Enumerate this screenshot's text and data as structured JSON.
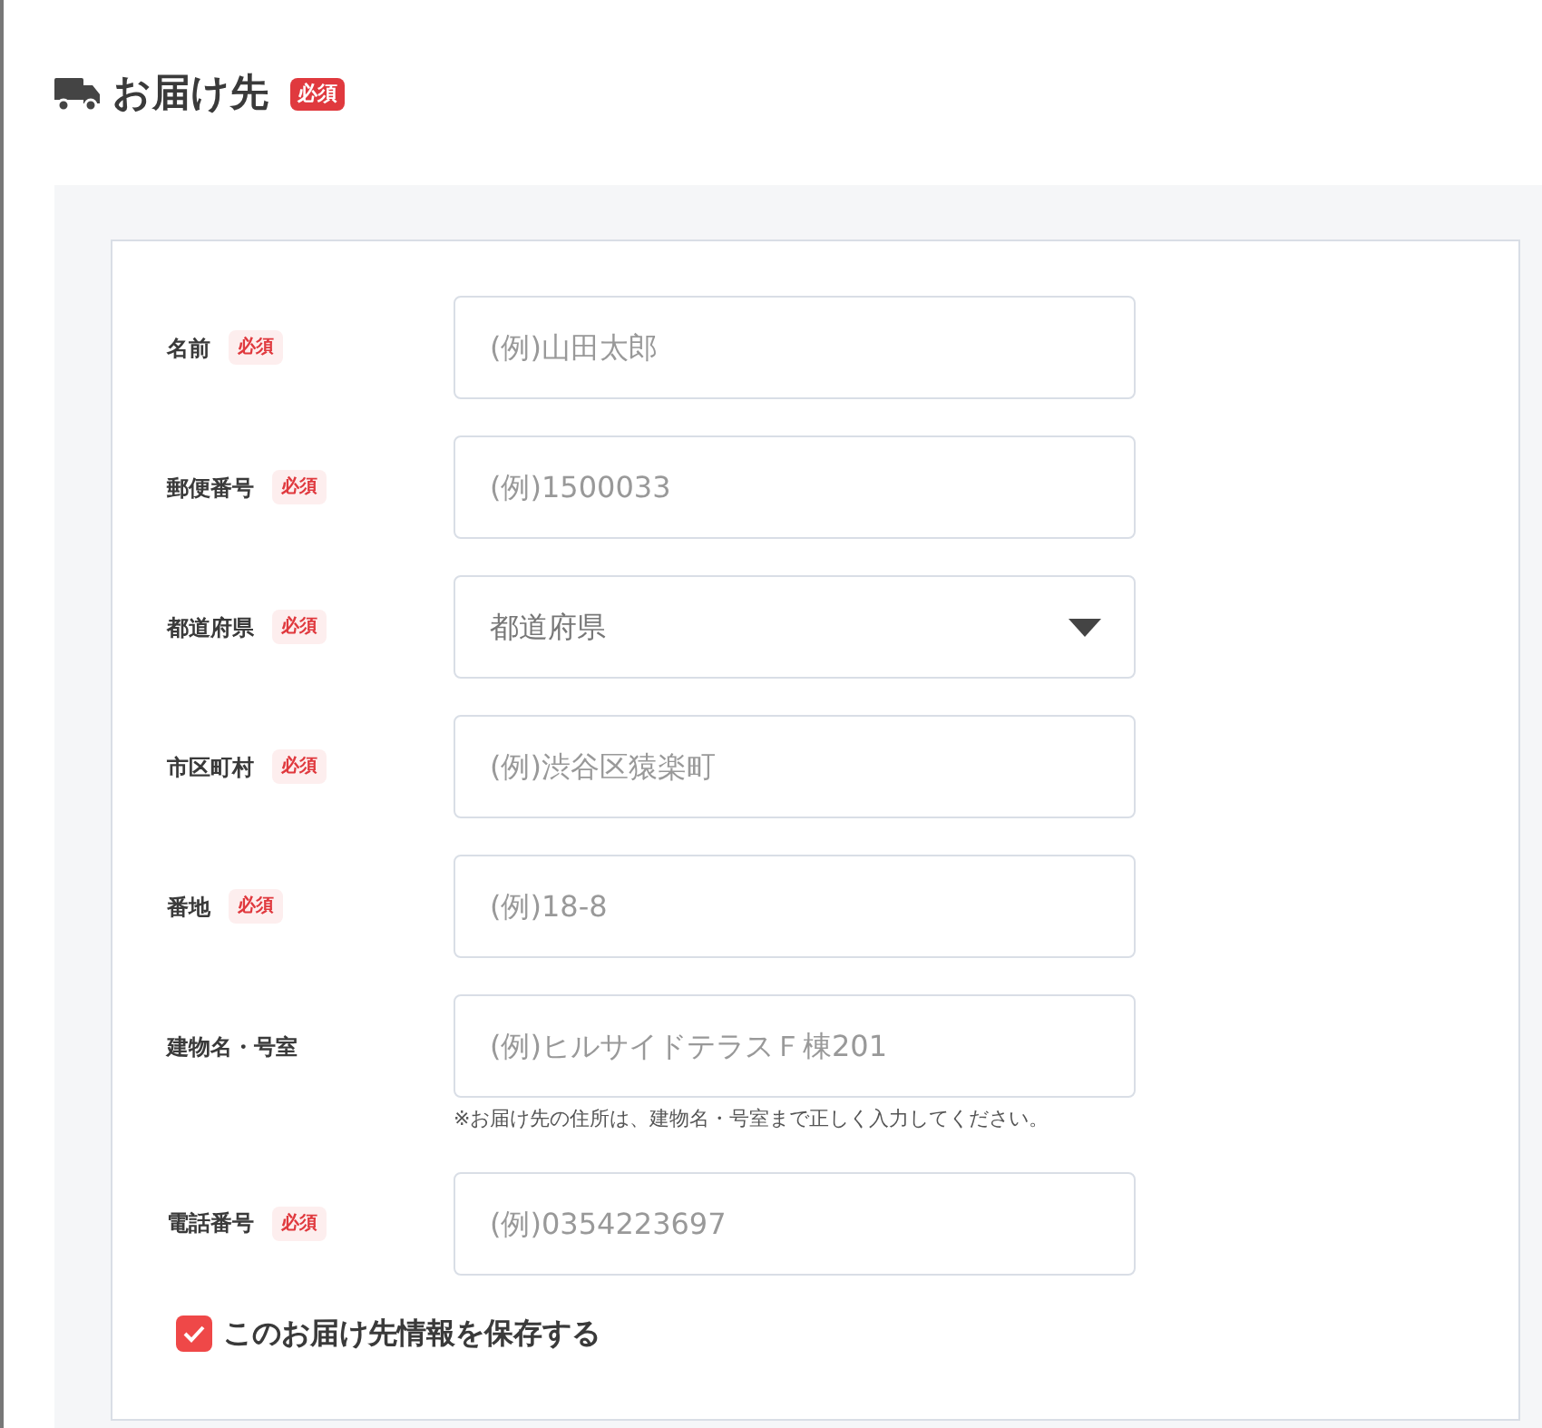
{
  "heading": {
    "title": "お届け先",
    "badge": "必須"
  },
  "fields": [
    {
      "label": "名前",
      "badge": "必須",
      "kind": "text",
      "placeholder": "(例)山田太郎"
    },
    {
      "label": "郵便番号",
      "badge": "必須",
      "kind": "text",
      "placeholder": "(例)1500033"
    },
    {
      "label": "都道府県",
      "badge": "必須",
      "kind": "select",
      "value": "都道府県"
    },
    {
      "label": "市区町村",
      "badge": "必須",
      "kind": "text",
      "placeholder": "(例)渋谷区猿楽町"
    },
    {
      "label": "番地",
      "badge": "必須",
      "kind": "text",
      "placeholder": "(例)18-8"
    },
    {
      "label": "建物名・号室",
      "kind": "text",
      "placeholder": "(例)ヒルサイドテラスＦ棟201",
      "note": "※お届け先の住所は、建物名・号室まで正しく入力してください。"
    },
    {
      "label": "電話番号",
      "badge": "必須",
      "kind": "text",
      "placeholder": "(例)0354223697"
    }
  ],
  "save_option": {
    "label": "このお届け先情報を保存する",
    "checked": true
  }
}
